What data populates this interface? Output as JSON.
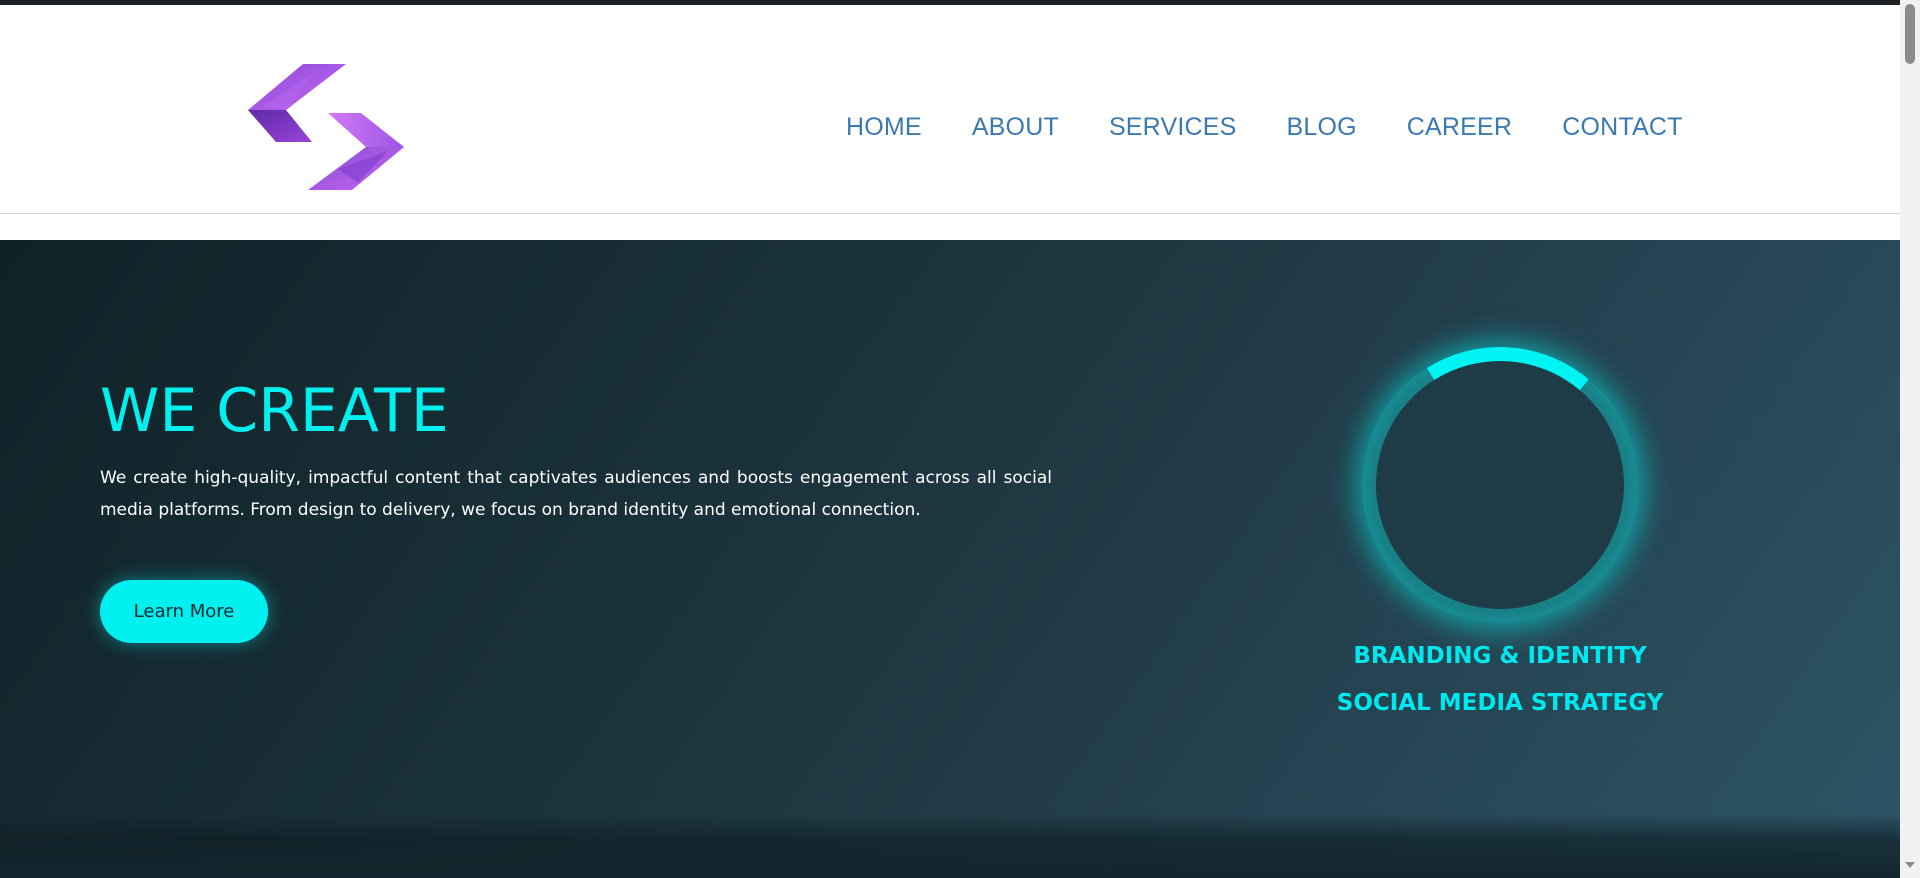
{
  "header": {
    "logo_icon": "double-chevron-logo",
    "nav": [
      {
        "label": "HOME"
      },
      {
        "label": "ABOUT"
      },
      {
        "label": "SERVICES"
      },
      {
        "label": "BLOG"
      },
      {
        "label": "CAREER"
      },
      {
        "label": "CONTACT"
      }
    ],
    "nav_color": "#3b7ab0"
  },
  "hero": {
    "title": "WE CREATE",
    "description": "We create high-quality, impactful content that captivates audiences and boosts engagement across all social media platforms. From design to delivery, we focus on brand identity and emotional connection.",
    "button_label": "Learn More",
    "accent_color": "#00f0f0",
    "services": {
      "previous": "BRANDING & IDENTITY",
      "current": "SOCIAL MEDIA STRATEGY"
    },
    "ring_progress": 0.2
  }
}
